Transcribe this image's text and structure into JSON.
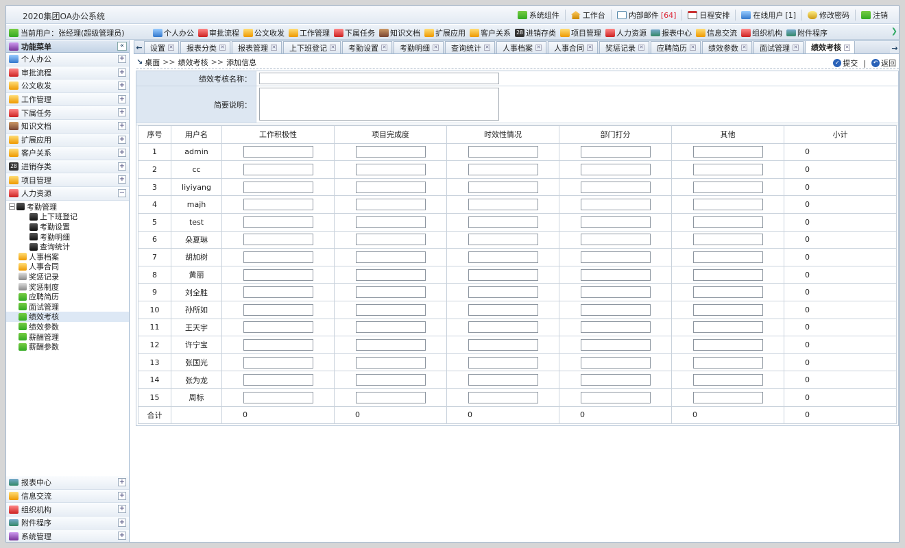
{
  "app": {
    "title": "2020集团OA办公系统"
  },
  "toplinks": [
    {
      "key": "components",
      "label": "系统组件",
      "icon": "gear-people-icon"
    },
    {
      "key": "workbench",
      "label": "工作台",
      "icon": "house-icon"
    },
    {
      "key": "mail",
      "label": "内部邮件",
      "count": "[64]",
      "icon": "mail-icon"
    },
    {
      "key": "schedule",
      "label": "日程安排",
      "icon": "calendar-icon"
    },
    {
      "key": "online",
      "label": "在线用户",
      "count": "[1]",
      "icon": "user-icon"
    },
    {
      "key": "password",
      "label": "修改密码",
      "icon": "key-icon"
    },
    {
      "key": "logout",
      "label": "注销",
      "icon": "logout-icon"
    }
  ],
  "userbar": {
    "current_user_label": "当前用户：",
    "current_user": "张经理(超级管理员)",
    "quicknav": [
      {
        "label": "个人办公",
        "icon": "personal-office-icon"
      },
      {
        "label": "审批流程",
        "icon": "approval-icon"
      },
      {
        "label": "公文收发",
        "icon": "documents-icon"
      },
      {
        "label": "工作管理",
        "icon": "work-icon"
      },
      {
        "label": "下属任务",
        "icon": "subordinate-task-icon"
      },
      {
        "label": "知识文档",
        "icon": "briefcase-icon"
      },
      {
        "label": "扩展应用",
        "icon": "extension-icon"
      },
      {
        "label": "客户关系",
        "icon": "customer-icon"
      },
      {
        "label": "进销存类",
        "icon": "inventory-icon"
      },
      {
        "label": "项目管理",
        "icon": "project-icon"
      },
      {
        "label": "人力资源",
        "icon": "hr-icon"
      },
      {
        "label": "报表中心",
        "icon": "report-icon"
      },
      {
        "label": "信息交流",
        "icon": "info-icon"
      },
      {
        "label": "组织机构",
        "icon": "org-icon"
      },
      {
        "label": "附件程序",
        "icon": "attachment-icon"
      }
    ]
  },
  "sidebar": {
    "title": "功能菜单",
    "collapse": "«",
    "menu_top": [
      {
        "label": "个人办公",
        "toggle": "+"
      },
      {
        "label": "审批流程",
        "toggle": "+"
      },
      {
        "label": "公文收发",
        "toggle": "+"
      },
      {
        "label": "工作管理",
        "toggle": "+"
      },
      {
        "label": "下属任务",
        "toggle": "+"
      },
      {
        "label": "知识文档",
        "toggle": "+"
      },
      {
        "label": "扩展应用",
        "toggle": "+"
      },
      {
        "label": "客户关系",
        "toggle": "+"
      },
      {
        "label": "进销存类",
        "toggle": "+"
      },
      {
        "label": "项目管理",
        "toggle": "+"
      },
      {
        "label": "人力资源",
        "toggle": "−"
      }
    ],
    "tree": {
      "group": "考勤管理",
      "group_toggle": "−",
      "children": [
        "上下班登记",
        "考勤设置",
        "考勤明细",
        "查询统计"
      ],
      "items": [
        "人事档案",
        "人事合同",
        "奖惩记录",
        "奖惩制度",
        "应聘简历",
        "面试管理",
        "绩效考核",
        "绩效参数",
        "薪酬管理",
        "薪酬参数"
      ],
      "active": "绩效考核"
    },
    "menu_bottom": [
      {
        "label": "报表中心",
        "toggle": "+"
      },
      {
        "label": "信息交流",
        "toggle": "+"
      },
      {
        "label": "组织机构",
        "toggle": "+"
      },
      {
        "label": "附件程序",
        "toggle": "+"
      },
      {
        "label": "系统管理",
        "toggle": "+"
      }
    ]
  },
  "tabs": {
    "left_arrow": "←",
    "right_arrow": "→",
    "close": "✕",
    "items": [
      "设置",
      "报表分类",
      "报表管理",
      "上下班登记",
      "考勤设置",
      "考勤明细",
      "查询统计",
      "人事档案",
      "人事合同",
      "奖惩记录",
      "应聘简历",
      "绩效参数",
      "面试管理",
      "绩效考核"
    ],
    "active": "绩效考核"
  },
  "breadcrumb": {
    "items": [
      "桌面",
      "绩效考核",
      "添加信息"
    ],
    "sep": ">>",
    "submit": "提交",
    "back": "返回",
    "divider": "|"
  },
  "form": {
    "name_label": "绩效考核名称：",
    "name_value": "",
    "desc_label": "简要说明：",
    "desc_value": ""
  },
  "table": {
    "headers": [
      "序号",
      "用户名",
      "工作积极性",
      "项目完成度",
      "时效性情况",
      "部门打分",
      "其他",
      "小计"
    ],
    "rows": [
      {
        "no": "1",
        "user": "admin",
        "subtotal": "0"
      },
      {
        "no": "2",
        "user": "cc",
        "subtotal": "0"
      },
      {
        "no": "3",
        "user": "liyiyang",
        "subtotal": "0"
      },
      {
        "no": "4",
        "user": "majh",
        "subtotal": "0"
      },
      {
        "no": "5",
        "user": "test",
        "subtotal": "0"
      },
      {
        "no": "6",
        "user": "朵夏琳",
        "subtotal": "0"
      },
      {
        "no": "7",
        "user": "胡加树",
        "subtotal": "0"
      },
      {
        "no": "8",
        "user": "黄丽",
        "subtotal": "0"
      },
      {
        "no": "9",
        "user": "刘全胜",
        "subtotal": "0"
      },
      {
        "no": "10",
        "user": "孙所如",
        "subtotal": "0"
      },
      {
        "no": "11",
        "user": "王天宇",
        "subtotal": "0"
      },
      {
        "no": "12",
        "user": "许宁宝",
        "subtotal": "0"
      },
      {
        "no": "13",
        "user": "张国光",
        "subtotal": "0"
      },
      {
        "no": "14",
        "user": "张为龙",
        "subtotal": "0"
      },
      {
        "no": "15",
        "user": "周标",
        "subtotal": "0"
      }
    ],
    "total_label": "合计",
    "totals": [
      "0",
      "0",
      "0",
      "0",
      "0",
      "0"
    ]
  }
}
